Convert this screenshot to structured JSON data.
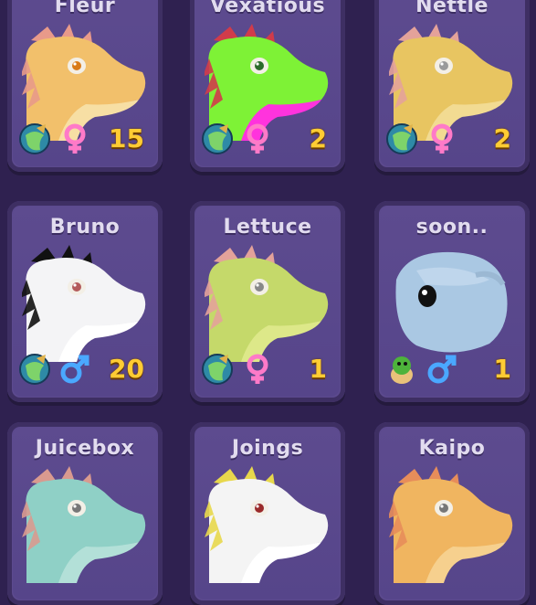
{
  "pets": [
    {
      "name": "Fleur",
      "age": "15",
      "gender": "female",
      "stage": "adult",
      "colors": {
        "main": "#f2c06b",
        "light": "#f7dfa4",
        "frill": "#e89a8a",
        "eye": "#d97b18"
      }
    },
    {
      "name": "Vexatious",
      "age": "2",
      "gender": "female",
      "stage": "adult",
      "colors": {
        "main": "#7ef236",
        "light": "#ff33dd",
        "frill": "#d13b4a",
        "eye": "#2a6b2a"
      }
    },
    {
      "name": "Nettle",
      "age": "2",
      "gender": "female",
      "stage": "adult",
      "colors": {
        "main": "#e8c561",
        "light": "#f2db92",
        "frill": "#e4a29a",
        "eye": "#9a9a9a"
      }
    },
    {
      "name": "Bruno",
      "age": "20",
      "gender": "male",
      "stage": "adult",
      "colors": {
        "main": "#f4f4f6",
        "light": "#ffffff",
        "frill": "#111111",
        "eye": "#b35a5a"
      }
    },
    {
      "name": "Lettuce",
      "age": "1",
      "gender": "female",
      "stage": "adult",
      "colors": {
        "main": "#c5d96a",
        "light": "#dde889",
        "frill": "#e3a29a",
        "eye": "#888888"
      }
    },
    {
      "name": "soon..",
      "age": "1",
      "gender": "male",
      "stage": "egg",
      "colors": {
        "main": "#aac8e3",
        "light": "#c8dcef",
        "frill": "#9bb8d3",
        "eye": "#111111"
      }
    },
    {
      "name": "Juicebox",
      "age": "",
      "gender": "",
      "stage": "adult",
      "colors": {
        "main": "#8fd0c6",
        "light": "#b3e0d8",
        "frill": "#d99a8f",
        "eye": "#777777"
      }
    },
    {
      "name": "Joings",
      "age": "",
      "gender": "",
      "stage": "adult",
      "colors": {
        "main": "#f4f4f4",
        "light": "#ffffff",
        "frill": "#e8d84c",
        "eye": "#9a2a2a"
      }
    },
    {
      "name": "Kaipo",
      "age": "",
      "gender": "",
      "stage": "adult",
      "colors": {
        "main": "#f0b560",
        "light": "#f6d08e",
        "frill": "#e78d5a",
        "eye": "#777777"
      }
    }
  ]
}
